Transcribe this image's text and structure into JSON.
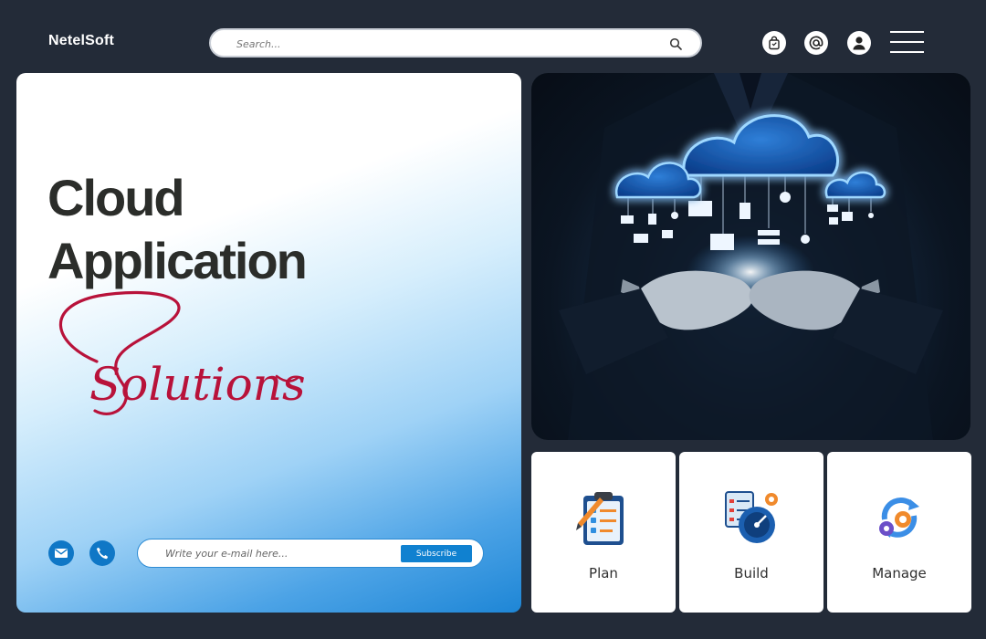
{
  "header": {
    "logo": "NetelSoft",
    "search": {
      "placeholder": "Search..."
    }
  },
  "hero": {
    "title_line1": "Cloud",
    "title_line2": "Application",
    "script_word": "Solutions",
    "email": {
      "placeholder": "Write your e-mail here...",
      "button_label": "Subscribe"
    }
  },
  "cards": [
    {
      "label": "Plan",
      "icon": "clipboard-checklist-icon"
    },
    {
      "label": "Build",
      "icon": "build-gauge-icon"
    },
    {
      "label": "Manage",
      "icon": "gears-refresh-icon"
    }
  ],
  "colors": {
    "background": "#232b38",
    "accent_blue": "#1081d0",
    "script_red": "#b8123a",
    "title": "#2b2d2a"
  }
}
